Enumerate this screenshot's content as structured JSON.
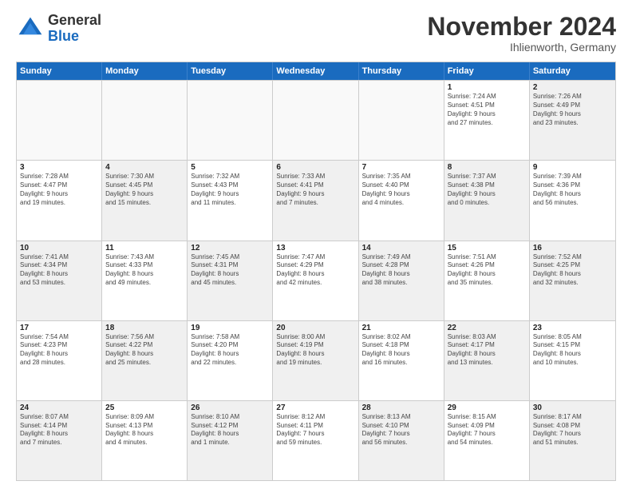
{
  "logo": {
    "general": "General",
    "blue": "Blue"
  },
  "title": "November 2024",
  "location": "Ihlienworth, Germany",
  "header_days": [
    "Sunday",
    "Monday",
    "Tuesday",
    "Wednesday",
    "Thursday",
    "Friday",
    "Saturday"
  ],
  "rows": [
    [
      {
        "day": "",
        "info": "",
        "empty": true
      },
      {
        "day": "",
        "info": "",
        "empty": true
      },
      {
        "day": "",
        "info": "",
        "empty": true
      },
      {
        "day": "",
        "info": "",
        "empty": true
      },
      {
        "day": "",
        "info": "",
        "empty": true
      },
      {
        "day": "1",
        "info": "Sunrise: 7:24 AM\nSunset: 4:51 PM\nDaylight: 9 hours\nand 27 minutes."
      },
      {
        "day": "2",
        "info": "Sunrise: 7:26 AM\nSunset: 4:49 PM\nDaylight: 9 hours\nand 23 minutes.",
        "shaded": true
      }
    ],
    [
      {
        "day": "3",
        "info": "Sunrise: 7:28 AM\nSunset: 4:47 PM\nDaylight: 9 hours\nand 19 minutes."
      },
      {
        "day": "4",
        "info": "Sunrise: 7:30 AM\nSunset: 4:45 PM\nDaylight: 9 hours\nand 15 minutes.",
        "shaded": true
      },
      {
        "day": "5",
        "info": "Sunrise: 7:32 AM\nSunset: 4:43 PM\nDaylight: 9 hours\nand 11 minutes."
      },
      {
        "day": "6",
        "info": "Sunrise: 7:33 AM\nSunset: 4:41 PM\nDaylight: 9 hours\nand 7 minutes.",
        "shaded": true
      },
      {
        "day": "7",
        "info": "Sunrise: 7:35 AM\nSunset: 4:40 PM\nDaylight: 9 hours\nand 4 minutes."
      },
      {
        "day": "8",
        "info": "Sunrise: 7:37 AM\nSunset: 4:38 PM\nDaylight: 9 hours\nand 0 minutes.",
        "shaded": true
      },
      {
        "day": "9",
        "info": "Sunrise: 7:39 AM\nSunset: 4:36 PM\nDaylight: 8 hours\nand 56 minutes."
      }
    ],
    [
      {
        "day": "10",
        "info": "Sunrise: 7:41 AM\nSunset: 4:34 PM\nDaylight: 8 hours\nand 53 minutes.",
        "shaded": true
      },
      {
        "day": "11",
        "info": "Sunrise: 7:43 AM\nSunset: 4:33 PM\nDaylight: 8 hours\nand 49 minutes."
      },
      {
        "day": "12",
        "info": "Sunrise: 7:45 AM\nSunset: 4:31 PM\nDaylight: 8 hours\nand 45 minutes.",
        "shaded": true
      },
      {
        "day": "13",
        "info": "Sunrise: 7:47 AM\nSunset: 4:29 PM\nDaylight: 8 hours\nand 42 minutes."
      },
      {
        "day": "14",
        "info": "Sunrise: 7:49 AM\nSunset: 4:28 PM\nDaylight: 8 hours\nand 38 minutes.",
        "shaded": true
      },
      {
        "day": "15",
        "info": "Sunrise: 7:51 AM\nSunset: 4:26 PM\nDaylight: 8 hours\nand 35 minutes."
      },
      {
        "day": "16",
        "info": "Sunrise: 7:52 AM\nSunset: 4:25 PM\nDaylight: 8 hours\nand 32 minutes.",
        "shaded": true
      }
    ],
    [
      {
        "day": "17",
        "info": "Sunrise: 7:54 AM\nSunset: 4:23 PM\nDaylight: 8 hours\nand 28 minutes."
      },
      {
        "day": "18",
        "info": "Sunrise: 7:56 AM\nSunset: 4:22 PM\nDaylight: 8 hours\nand 25 minutes.",
        "shaded": true
      },
      {
        "day": "19",
        "info": "Sunrise: 7:58 AM\nSunset: 4:20 PM\nDaylight: 8 hours\nand 22 minutes."
      },
      {
        "day": "20",
        "info": "Sunrise: 8:00 AM\nSunset: 4:19 PM\nDaylight: 8 hours\nand 19 minutes.",
        "shaded": true
      },
      {
        "day": "21",
        "info": "Sunrise: 8:02 AM\nSunset: 4:18 PM\nDaylight: 8 hours\nand 16 minutes."
      },
      {
        "day": "22",
        "info": "Sunrise: 8:03 AM\nSunset: 4:17 PM\nDaylight: 8 hours\nand 13 minutes.",
        "shaded": true
      },
      {
        "day": "23",
        "info": "Sunrise: 8:05 AM\nSunset: 4:15 PM\nDaylight: 8 hours\nand 10 minutes."
      }
    ],
    [
      {
        "day": "24",
        "info": "Sunrise: 8:07 AM\nSunset: 4:14 PM\nDaylight: 8 hours\nand 7 minutes.",
        "shaded": true
      },
      {
        "day": "25",
        "info": "Sunrise: 8:09 AM\nSunset: 4:13 PM\nDaylight: 8 hours\nand 4 minutes."
      },
      {
        "day": "26",
        "info": "Sunrise: 8:10 AM\nSunset: 4:12 PM\nDaylight: 8 hours\nand 1 minute.",
        "shaded": true
      },
      {
        "day": "27",
        "info": "Sunrise: 8:12 AM\nSunset: 4:11 PM\nDaylight: 7 hours\nand 59 minutes."
      },
      {
        "day": "28",
        "info": "Sunrise: 8:13 AM\nSunset: 4:10 PM\nDaylight: 7 hours\nand 56 minutes.",
        "shaded": true
      },
      {
        "day": "29",
        "info": "Sunrise: 8:15 AM\nSunset: 4:09 PM\nDaylight: 7 hours\nand 54 minutes."
      },
      {
        "day": "30",
        "info": "Sunrise: 8:17 AM\nSunset: 4:08 PM\nDaylight: 7 hours\nand 51 minutes.",
        "shaded": true
      }
    ]
  ]
}
